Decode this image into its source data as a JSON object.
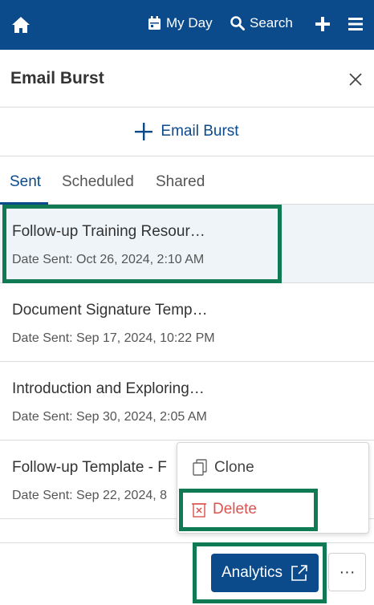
{
  "topbar": {
    "home_icon": "home-icon",
    "my_day_label": "My Day",
    "search_label": "Search",
    "add_icon": "plus-icon",
    "menu_icon": "hamburger-menu-icon",
    "background_color": "#0b4a8b"
  },
  "panel": {
    "title": "Email Burst",
    "close_icon": "close-icon",
    "add_button_label": "Email Burst"
  },
  "tabs": [
    {
      "label": "Sent",
      "active": true
    },
    {
      "label": "Scheduled",
      "active": false
    },
    {
      "label": "Shared",
      "active": false
    }
  ],
  "items": [
    {
      "title": "Follow-up Training Resour…",
      "date": "Date Sent: Oct 26, 2024, 2:10 AM",
      "selected": true
    },
    {
      "title": "Document Signature Temp…",
      "date": "Date Sent: Sep 17, 2024, 10:22 PM",
      "selected": false
    },
    {
      "title": "Introduction and Exploring…",
      "date": "Date Sent: Sep 30, 2024, 2:05 AM",
      "selected": false
    },
    {
      "title": "Follow-up Template - F",
      "date": "Date Sent: Sep 22, 2024, 8",
      "selected": false
    }
  ],
  "context_menu": {
    "clone_label": "Clone",
    "delete_label": "Delete",
    "delete_color": "#d9534f"
  },
  "footer": {
    "analytics_label": "Analytics",
    "more_label": "···"
  },
  "colors": {
    "primary": "#0b4a8b",
    "highlight": "#0f7a54",
    "selected_row": "#eef4f8"
  }
}
